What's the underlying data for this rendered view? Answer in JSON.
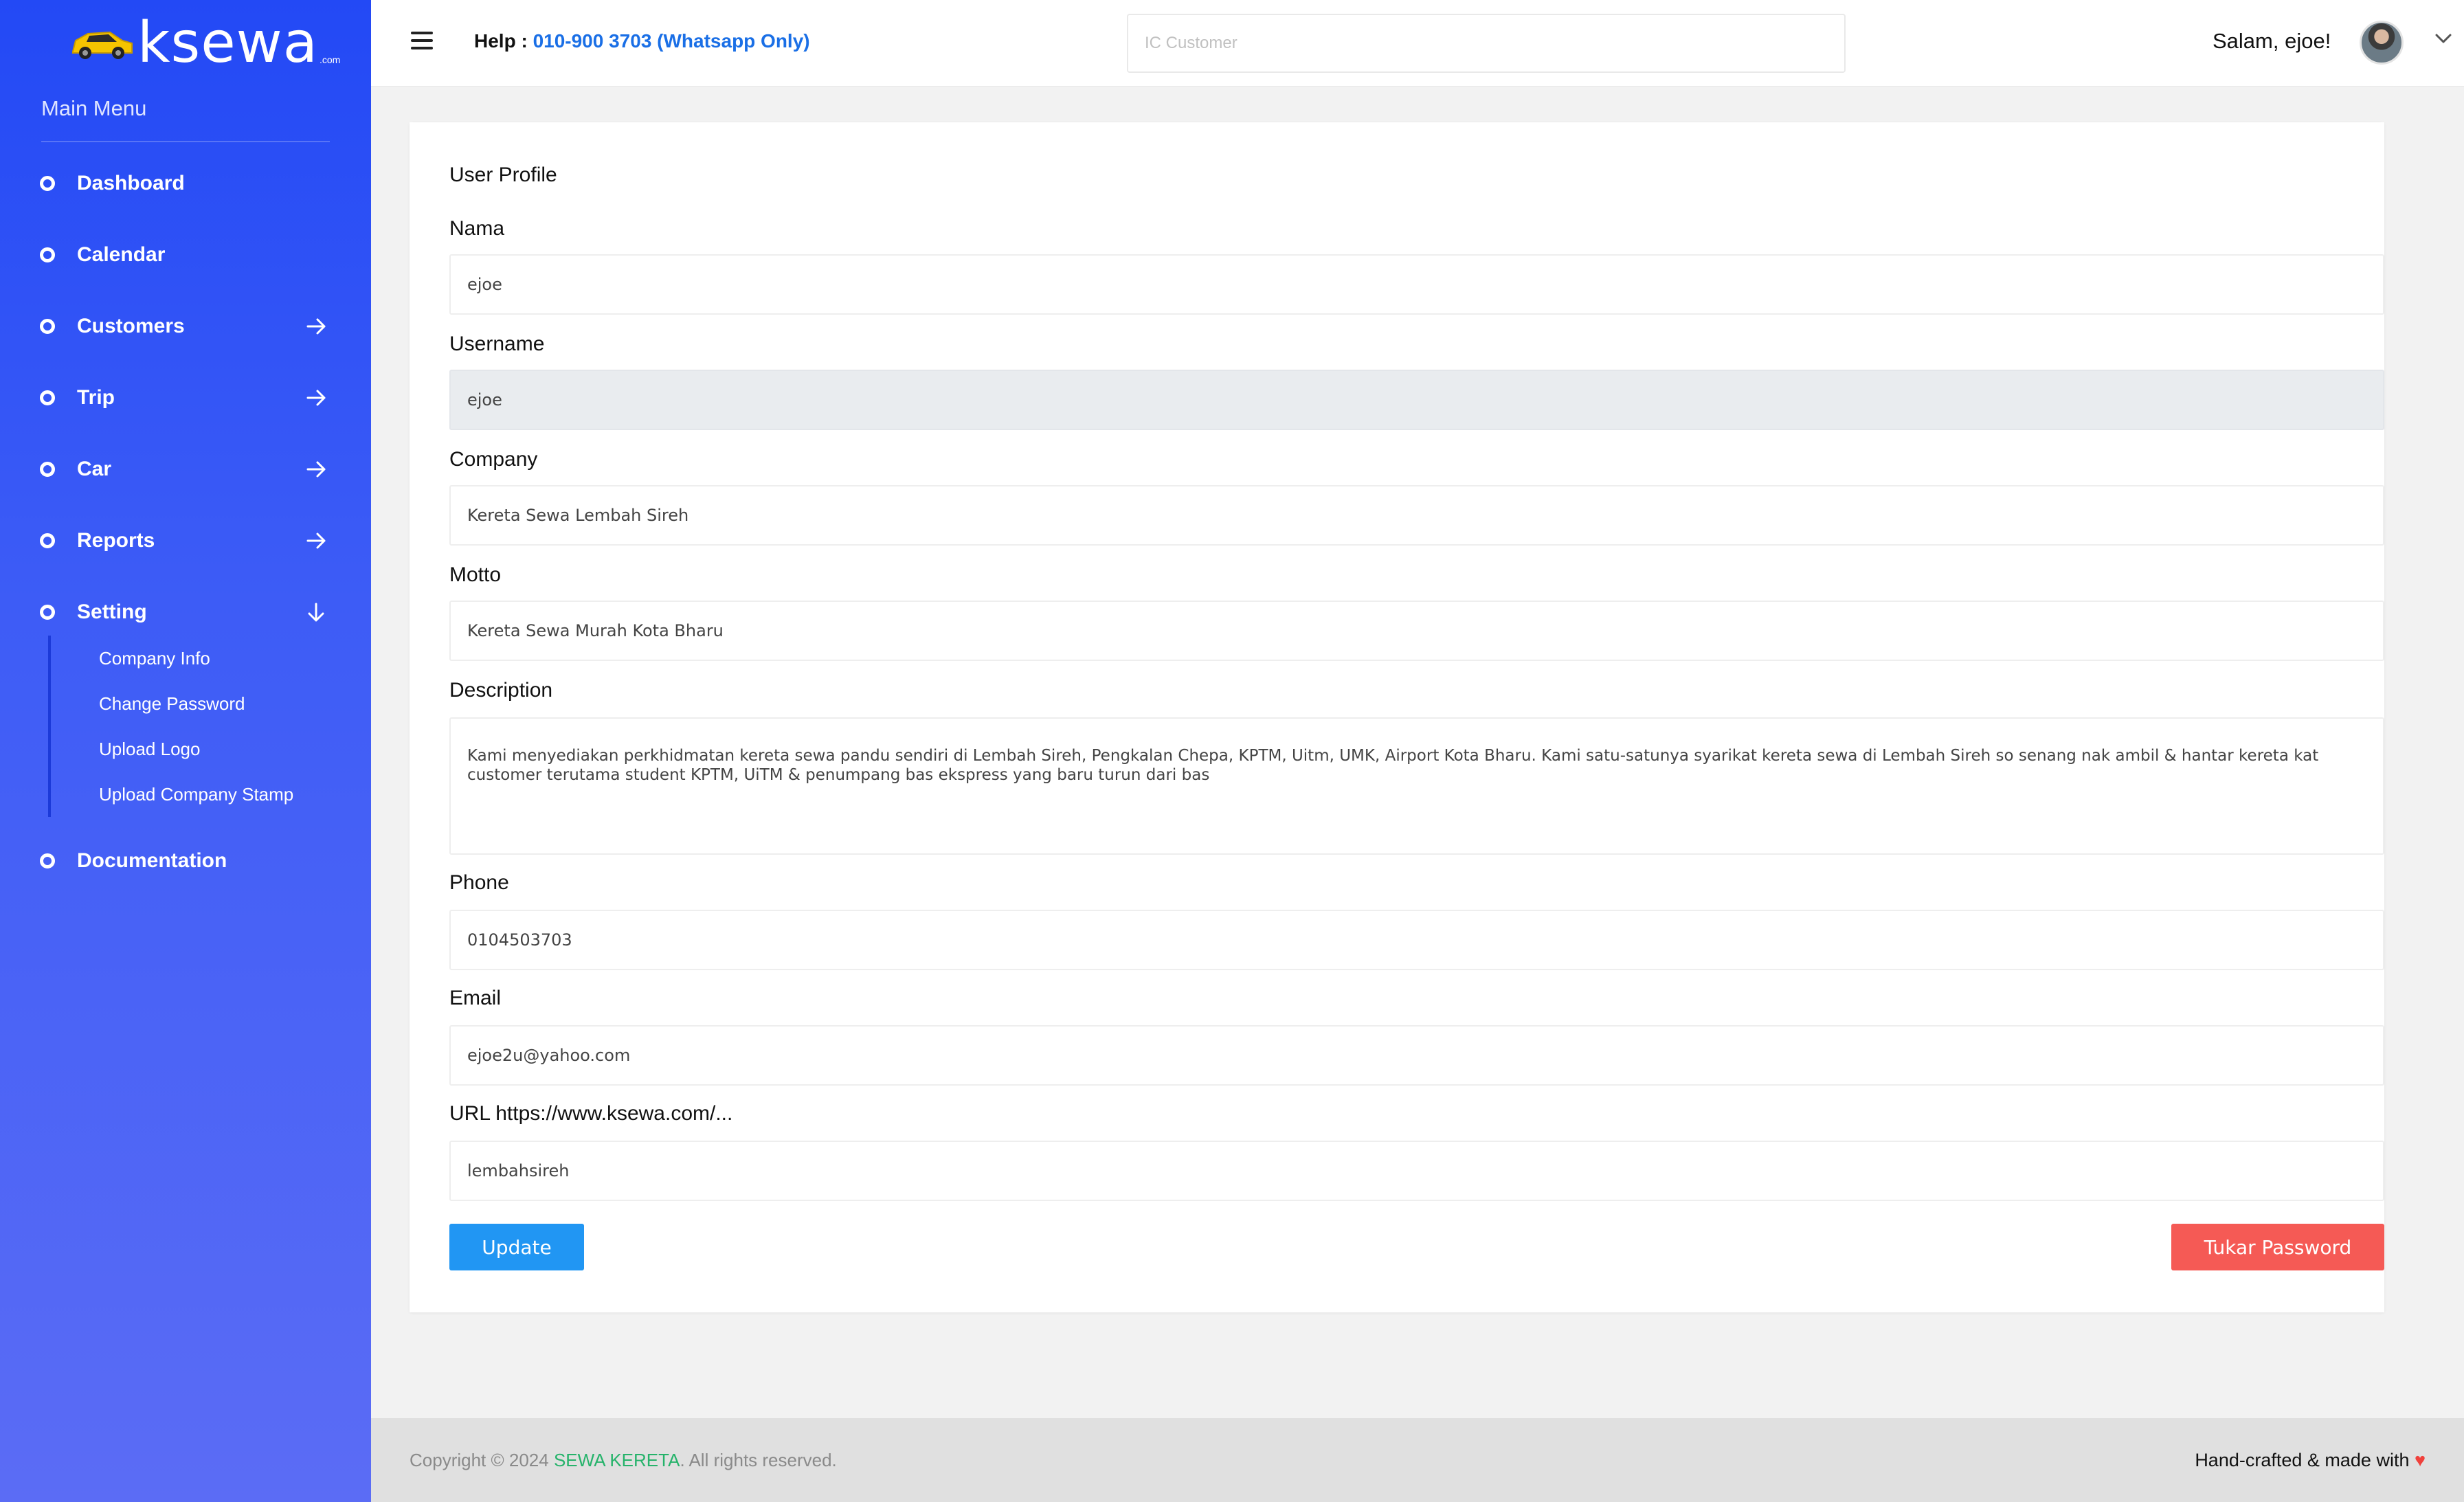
{
  "sidebar": {
    "logo_text": "ksewa",
    "logo_tld": ".com",
    "main_menu_label": "Main Menu",
    "items": [
      {
        "label": "Dashboard",
        "arrow": "none"
      },
      {
        "label": "Calendar",
        "arrow": "none"
      },
      {
        "label": "Customers",
        "arrow": "right"
      },
      {
        "label": "Trip",
        "arrow": "right"
      },
      {
        "label": "Car",
        "arrow": "right"
      },
      {
        "label": "Reports",
        "arrow": "right"
      },
      {
        "label": "Setting",
        "arrow": "down"
      },
      {
        "label": "Documentation",
        "arrow": "none"
      }
    ],
    "setting_submenu": [
      "Company Info",
      "Change Password",
      "Upload Logo",
      "Upload Company Stamp"
    ]
  },
  "header": {
    "help_label": "Help : ",
    "help_phone": "010-900 3703 (Whatsapp Only)",
    "search_placeholder": "IC Customer",
    "greeting": "Salam, ejoe!"
  },
  "profile": {
    "title": "User Profile",
    "nama_label": "Nama",
    "nama_value": "ejoe",
    "username_label": "Username",
    "username_value": "ejoe",
    "company_label": "Company",
    "company_value": "Kereta Sewa Lembah Sireh",
    "motto_label": "Motto",
    "motto_value": "Kereta Sewa Murah Kota Bharu",
    "description_label": "Description",
    "description_value": "Kami menyediakan perkhidmatan kereta sewa pandu sendiri di Lembah Sireh, Pengkalan Chepa, KPTM, Uitm, UMK, Airport Kota Bharu. Kami satu-satunya syarikat kereta sewa di Lembah Sireh so senang nak ambil & hantar kereta kat customer terutama student KPTM, UiTM & penumpang bas ekspress yang baru turun dari bas",
    "phone_label": "Phone",
    "phone_value": "0104503703",
    "email_label": "Email",
    "email_value": "ejoe2u@yahoo.com",
    "url_label": "URL https://www.ksewa.com/...",
    "url_value": "lembahsireh",
    "update_button": "Update",
    "tukar_button": "Tukar Password"
  },
  "footer": {
    "copyright_prefix": "Copyright © 2024 ",
    "copyright_brand": "SEWA KERETA",
    "copyright_suffix": ". All rights reserved.",
    "made_with": "Hand-crafted & made with ",
    "heart": "♥"
  },
  "colors": {
    "sidebar_top": "#2349f5",
    "sidebar_bottom": "#5b6cf5",
    "help_phone": "#1a6fe6",
    "update_button": "#2196f3",
    "tukar_button": "#f55a55",
    "footer_brand": "#26b36b",
    "heart": "#f0413c"
  }
}
